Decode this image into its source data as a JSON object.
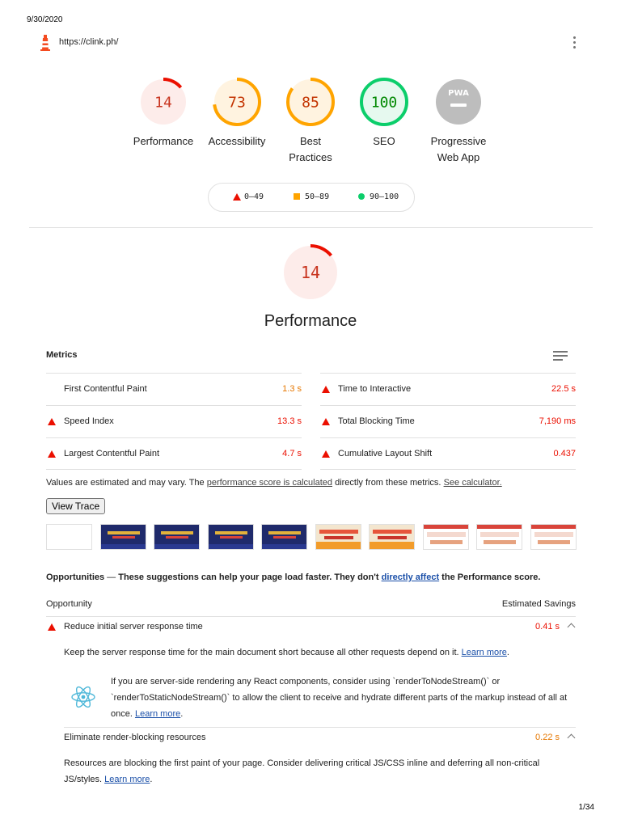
{
  "print": {
    "date": "9/30/2020",
    "page": "1/34"
  },
  "header": {
    "url": "https://clink.ph/",
    "menu_icon": "kebab-menu-icon",
    "logo_icon": "lighthouse-icon"
  },
  "colors": {
    "fail": "#eb0f00",
    "average": "#ffa400",
    "pass": "#0cce6b",
    "pwa": "#bdbdbd"
  },
  "gauges": [
    {
      "score": "14",
      "label_line1": "Performance",
      "label_line2": "",
      "rating": "fail",
      "fraction": 0.14
    },
    {
      "score": "73",
      "label_line1": "Accessibility",
      "label_line2": "",
      "rating": "average",
      "fraction": 0.73
    },
    {
      "score": "85",
      "label_line1": "Best",
      "label_line2": "Practices",
      "rating": "average",
      "fraction": 0.85
    },
    {
      "score": "100",
      "label_line1": "SEO",
      "label_line2": "",
      "rating": "pass",
      "fraction": 1.0
    },
    {
      "score": "PWA",
      "label_line1": "Progressive",
      "label_line2": "Web App",
      "rating": "pwa",
      "fraction": 0
    }
  ],
  "legend": {
    "fail": "0–49",
    "average": "50–89",
    "pass": "90–100"
  },
  "performance": {
    "score": "14",
    "fraction": 0.14,
    "title": "Performance"
  },
  "metrics": {
    "heading": "Metrics",
    "left": [
      {
        "name": "First Contentful Paint",
        "value": "1.3 s",
        "rating": "average"
      },
      {
        "name": "Speed Index",
        "value": "13.3 s",
        "rating": "fail"
      },
      {
        "name": "Largest Contentful Paint",
        "value": "4.7 s",
        "rating": "fail"
      }
    ],
    "right": [
      {
        "name": "Time to Interactive",
        "value": "22.5 s",
        "rating": "fail"
      },
      {
        "name": "Total Blocking Time",
        "value": "7,190 ms",
        "rating": "fail"
      },
      {
        "name": "Cumulative Layout Shift",
        "value": "0.437",
        "rating": "fail"
      }
    ],
    "note_pre": "Values are estimated and may vary. The ",
    "note_link1": "performance score is calculated",
    "note_mid": " directly from these metrics. ",
    "note_link2": "See calculator."
  },
  "view_trace": "View Trace",
  "filmstrip": [
    "blank",
    "dark",
    "dark",
    "dark",
    "dark",
    "orange",
    "orange",
    "light",
    "light",
    "light"
  ],
  "opportunities": {
    "heading": "Opportunities",
    "dash": " — ",
    "text_pre": "These suggestions can help your page load faster. They don't ",
    "link": "directly affect",
    "text_post": " the Performance score.",
    "col_left": "Opportunity",
    "col_right": "Estimated Savings"
  },
  "audits": [
    {
      "title": "Reduce initial server response time",
      "savings": "0.41 s",
      "desc": "Keep the server response time for the main document short because all other requests depend on it. ",
      "learn": "Learn more",
      "end": "."
    },
    {
      "title": "Eliminate render-blocking resources",
      "savings": "0.22 s",
      "desc": "Resources are blocking the first paint of your page. Consider delivering critical JS/CSS inline and deferring all non-critical JS/styles. ",
      "learn": "Learn more",
      "end": "."
    }
  ],
  "react_hint": {
    "text": "If you are server-side rendering any React components, consider using `renderToNodeStream()` or `renderToStaticNodeStream()` to allow the client to receive and hydrate different parts of the markup instead of all at once. ",
    "learn": "Learn more",
    "end": ".",
    "icon": "react-icon"
  }
}
